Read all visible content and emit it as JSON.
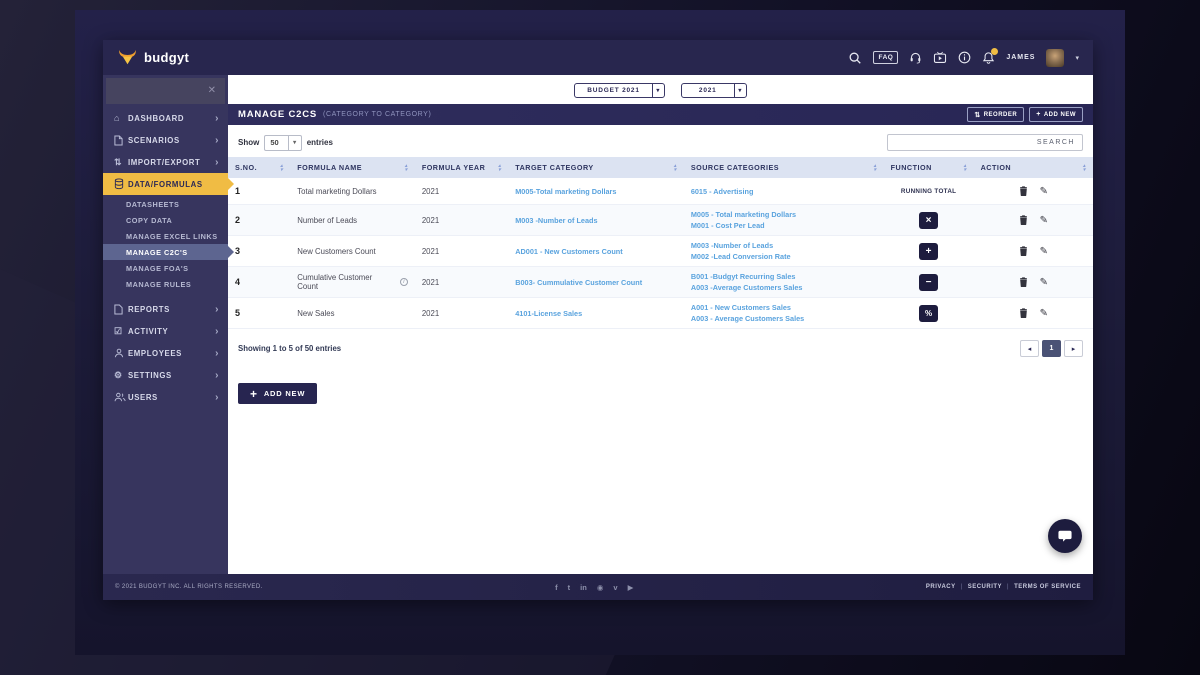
{
  "chrome": {
    "logo_text": "budgyt",
    "faq_label": "FAQ",
    "user_name": "JAMES"
  },
  "sidebar": {
    "main_items": [
      {
        "label": "DASHBOARD",
        "icon": "home-icon"
      },
      {
        "label": "SCENARIOS",
        "icon": "document-icon"
      },
      {
        "label": "IMPORT/EXPORT",
        "icon": "import-export-icon"
      },
      {
        "label": "DATA/FORMULAS",
        "icon": "database-icon",
        "active": true
      },
      {
        "label": "REPORTS",
        "icon": "report-icon"
      },
      {
        "label": "ACTIVITY",
        "icon": "checkbox-icon"
      },
      {
        "label": "EMPLOYEES",
        "icon": "person-icon"
      },
      {
        "label": "SETTINGS",
        "icon": "gear-icon"
      },
      {
        "label": "USERS",
        "icon": "people-icon"
      }
    ],
    "submenu_items": [
      {
        "label": "DATASHEETS"
      },
      {
        "label": "COPY DATA"
      },
      {
        "label": "MANAGE EXCEL LINKS"
      },
      {
        "label": "MANAGE C2C'S",
        "active": true
      },
      {
        "label": "MANAGE FOA'S"
      },
      {
        "label": "MANAGE RULES"
      }
    ]
  },
  "filters": {
    "budget_dropdown": "BUDGET 2021",
    "year_dropdown": "2021"
  },
  "page": {
    "title": "MANAGE C2CS",
    "subtitle": "(CATEGORY TO CATEGORY)",
    "reorder_label": "REORDER",
    "add_new_label": "ADD NEW",
    "show_label": "Show",
    "page_size": "50",
    "entries_label": "entries",
    "search_placeholder": "SEARCH",
    "showing_text": "Showing 1 to 5 of 50 entries",
    "current_page": "1",
    "add_new_bottom_label": "ADD NEW"
  },
  "table": {
    "headers": [
      "S.NO.",
      "FORMULA NAME",
      "FORMULA YEAR",
      "TARGET CATEGORY",
      "SOURCE CATEGORIES",
      "FUNCTION",
      "ACTION"
    ],
    "rows": [
      {
        "sno": "1",
        "name": "Total marketing Dollars",
        "year": "2021",
        "target": "M005-Total marketing Dollars",
        "source1": "6015 - Advertising",
        "source2": "",
        "function_text": "RUNNING TOTAL"
      },
      {
        "sno": "2",
        "name": "Number of Leads",
        "year": "2021",
        "target": "M003 -Number of Leads",
        "source1": "M005 - Total marketing Dollars",
        "source2": "M001 - Cost Per Lead",
        "function_symbol": "×"
      },
      {
        "sno": "3",
        "name": "New Customers Count",
        "year": "2021",
        "target": "AD001 - New Customers Count",
        "source1": "M003 -Number of Leads",
        "source2": "M002 -Lead Conversion Rate",
        "function_symbol": "+"
      },
      {
        "sno": "4",
        "name": "Cumulative Customer Count",
        "year": "2021",
        "target": "B003- Cummulative Customer Count",
        "source1": "B001 -Budgyt Recurring Sales",
        "source2": "A003 -Average Customers Sales",
        "function_symbol": "−"
      },
      {
        "sno": "5",
        "name": "New Sales",
        "year": "2021",
        "target": "4101-License Sales",
        "source1": "A001 - New Customers Sales",
        "source2": "A003 - Average Customers Sales",
        "function_symbol": "%"
      }
    ]
  },
  "footer": {
    "copyright": "© 2021 BUDGYT INC. ALL RIGHTS RESERVED.",
    "links": [
      "PRIVACY",
      "SECURITY",
      "TERMS OF SERVICE"
    ],
    "social_icons": [
      "facebook-icon",
      "twitter-icon",
      "linkedin-icon",
      "instagram-icon",
      "vimeo-icon",
      "youtube-icon"
    ]
  },
  "colors": {
    "accent_yellow": "#f0bc44",
    "navy": "#2b2956",
    "link_blue": "#5aa3de",
    "table_header_bg": "#dce3f2"
  }
}
